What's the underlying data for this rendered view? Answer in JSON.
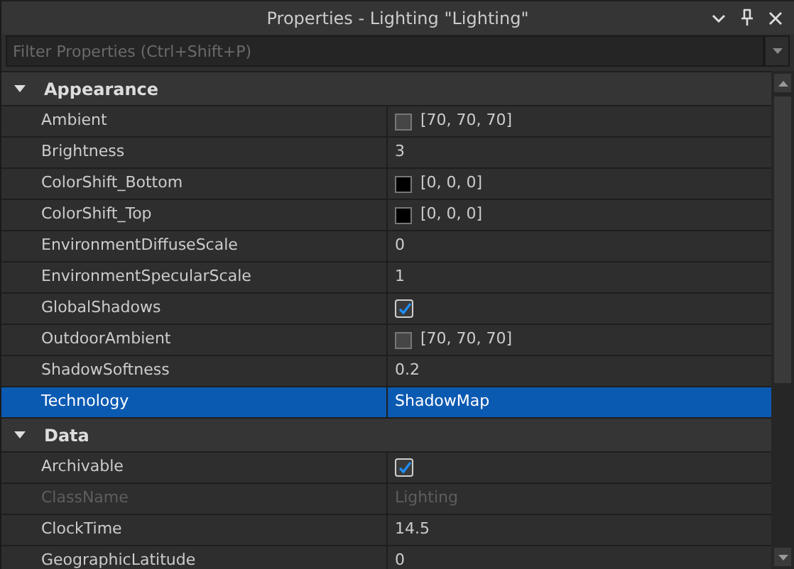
{
  "window": {
    "title": "Properties - Lighting \"Lighting\""
  },
  "filter": {
    "placeholder": "Filter Properties (Ctrl+Shift+P)"
  },
  "sections": [
    {
      "title": "Appearance",
      "expanded": true,
      "rows": [
        {
          "name": "Ambient",
          "kind": "color",
          "value": "[70, 70, 70]",
          "color": "#464646",
          "selected": false,
          "disabled": false
        },
        {
          "name": "Brightness",
          "kind": "text",
          "value": "3",
          "selected": false,
          "disabled": false
        },
        {
          "name": "ColorShift_Bottom",
          "kind": "color",
          "value": "[0, 0, 0]",
          "color": "#000000",
          "selected": false,
          "disabled": false
        },
        {
          "name": "ColorShift_Top",
          "kind": "color",
          "value": "[0, 0, 0]",
          "color": "#000000",
          "selected": false,
          "disabled": false
        },
        {
          "name": "EnvironmentDiffuseScale",
          "kind": "text",
          "value": "0",
          "selected": false,
          "disabled": false
        },
        {
          "name": "EnvironmentSpecularScale",
          "kind": "text",
          "value": "1",
          "selected": false,
          "disabled": false
        },
        {
          "name": "GlobalShadows",
          "kind": "checkbox",
          "checked": true,
          "selected": false,
          "disabled": false
        },
        {
          "name": "OutdoorAmbient",
          "kind": "color",
          "value": "[70, 70, 70]",
          "color": "#464646",
          "selected": false,
          "disabled": false
        },
        {
          "name": "ShadowSoftness",
          "kind": "text",
          "value": "0.2",
          "selected": false,
          "disabled": false
        },
        {
          "name": "Technology",
          "kind": "text",
          "value": "ShadowMap",
          "selected": true,
          "disabled": false
        }
      ]
    },
    {
      "title": "Data",
      "expanded": true,
      "rows": [
        {
          "name": "Archivable",
          "kind": "checkbox",
          "checked": true,
          "selected": false,
          "disabled": false
        },
        {
          "name": "ClassName",
          "kind": "text",
          "value": "Lighting",
          "selected": false,
          "disabled": true
        },
        {
          "name": "ClockTime",
          "kind": "text",
          "value": "14.5",
          "selected": false,
          "disabled": false
        },
        {
          "name": "GeographicLatitude",
          "kind": "text",
          "value": "0",
          "selected": false,
          "disabled": false
        }
      ]
    }
  ]
}
